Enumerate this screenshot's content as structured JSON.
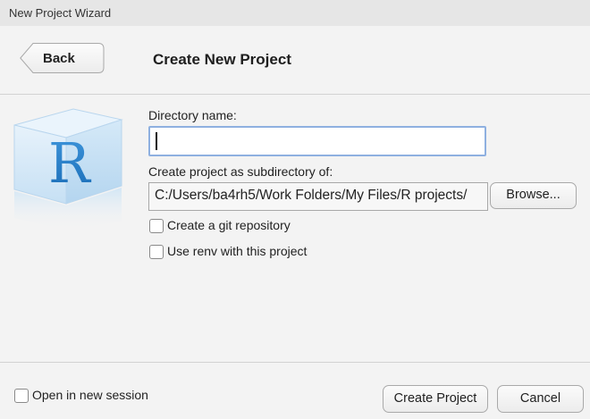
{
  "window": {
    "title": "New Project Wizard"
  },
  "header": {
    "back_label": "Back",
    "title": "Create New Project"
  },
  "form": {
    "directory_label": "Directory name:",
    "directory_value": "",
    "subdir_label": "Create project as subdirectory of:",
    "subdir_value": "C:/Users/ba4rh5/Work Folders/My Files/R projects/",
    "browse_label": "Browse...",
    "git_label": "Create a git repository",
    "git_checked": false,
    "renv_label": "Use renv with this project",
    "renv_checked": false
  },
  "footer": {
    "new_session_label": "Open in new session",
    "new_session_checked": false,
    "create_label": "Create Project",
    "cancel_label": "Cancel"
  },
  "colors": {
    "input_focus_border": "#8eb0e0",
    "r_logo_blue": "#1f78c8"
  }
}
